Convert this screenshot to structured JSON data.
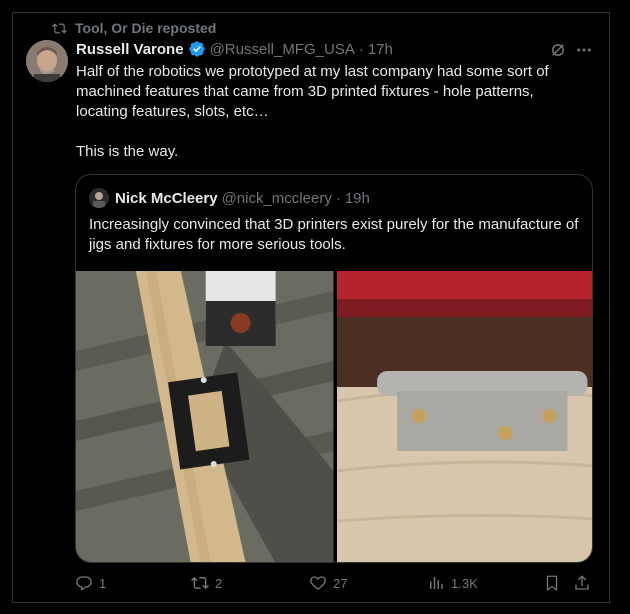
{
  "repost": {
    "text": "Tool, Or Die reposted"
  },
  "author": {
    "name": "Russell Varone",
    "handle": "@Russell_MFG_USA",
    "separator": "·",
    "time": "17h"
  },
  "post": {
    "paragraphs": [
      "Half of the robotics we prototyped at my last company had some sort of machined features that came from 3D printed fixtures - hole patterns, locating features, slots, etc…",
      "This is the way."
    ]
  },
  "quote": {
    "author": {
      "name": "Nick McCleery",
      "handle": "@nick_mccleery",
      "separator": "·",
      "time": "19h"
    },
    "text": "Increasingly convinced that 3D printers exist purely for the manufacture of jigs and fixtures for more serious tools."
  },
  "actions": {
    "replies": "1",
    "reposts": "2",
    "likes": "27",
    "views": "1.3K"
  },
  "icons": {
    "repost": "repost-icon",
    "verified": "verified-badge-icon",
    "grok": "grok-icon",
    "more": "more-icon",
    "reply": "reply-icon",
    "like": "heart-icon",
    "views": "views-icon",
    "bookmark": "bookmark-icon",
    "share": "share-icon"
  },
  "colors": {
    "background": "#000000",
    "text": "#e7e9ea",
    "muted": "#71767b",
    "border": "#2f3336",
    "verified": "#1d9bf0"
  }
}
